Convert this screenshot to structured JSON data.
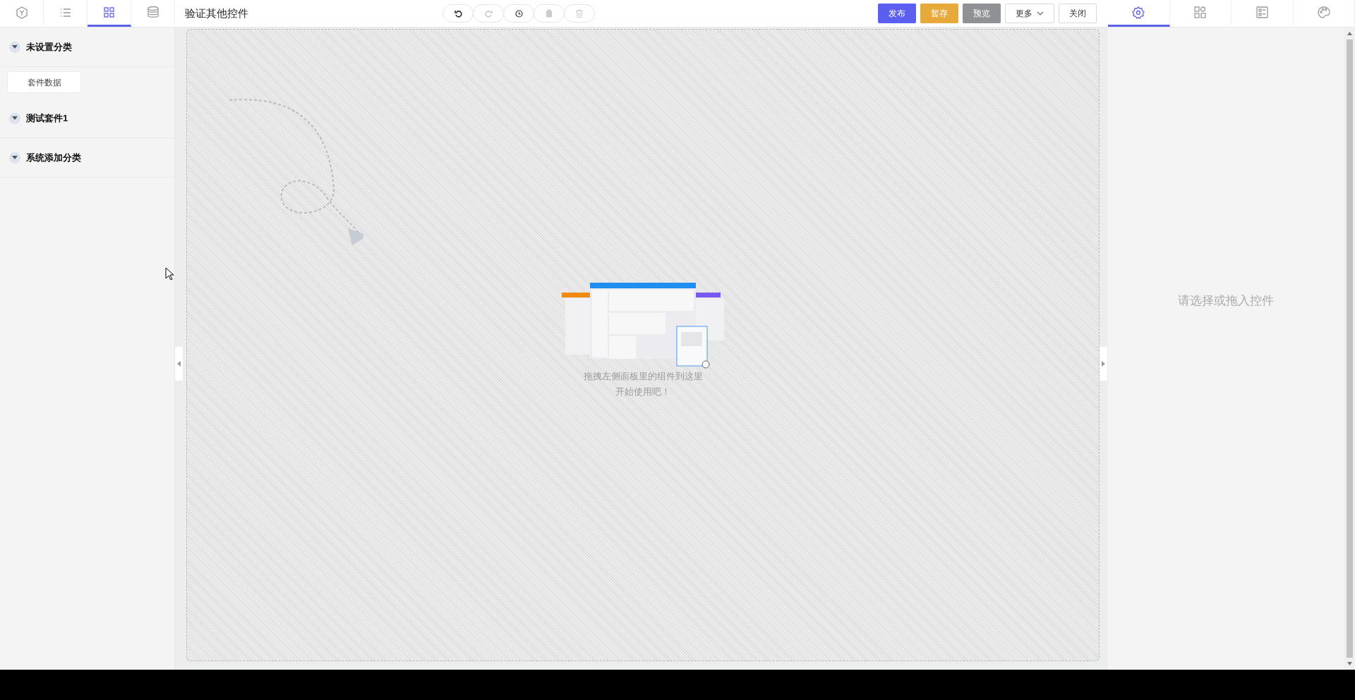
{
  "left_tabs": [
    {
      "kind": "cube",
      "selected": false
    },
    {
      "kind": "list",
      "selected": false
    },
    {
      "kind": "grid",
      "selected": true
    },
    {
      "kind": "database",
      "selected": false
    }
  ],
  "title": "验证其他控件",
  "toolbar": [
    {
      "kind": "undo",
      "disabled": false
    },
    {
      "kind": "redo",
      "disabled": true
    },
    {
      "kind": "history",
      "disabled": false
    },
    {
      "kind": "paste",
      "disabled": true
    },
    {
      "kind": "delete",
      "disabled": true
    }
  ],
  "actions": [
    {
      "label": "发布",
      "kind": "publish"
    },
    {
      "label": "暂存",
      "kind": "save"
    },
    {
      "label": "预览",
      "kind": "preview"
    },
    {
      "label": "更多",
      "kind": "dropdown"
    },
    {
      "label": "关闭",
      "kind": "plain"
    }
  ],
  "right_tabs": [
    {
      "kind": "settings",
      "selected": true
    },
    {
      "kind": "components",
      "selected": false
    },
    {
      "kind": "form",
      "selected": false
    },
    {
      "kind": "palette",
      "selected": false
    }
  ],
  "sidebar": {
    "groups": [
      {
        "title": "未设置分类",
        "expanded": true,
        "items": [
          "套件数据"
        ]
      },
      {
        "title": "测试套件1",
        "expanded": true
      },
      {
        "title": "系统添加分类",
        "expanded": true
      }
    ]
  },
  "canvas": {
    "hint_lines": [
      "拖拽左侧面板里的组件到这里",
      "开始使用吧！"
    ]
  },
  "properties": {
    "empty_text": "请选择或拖入控件"
  }
}
